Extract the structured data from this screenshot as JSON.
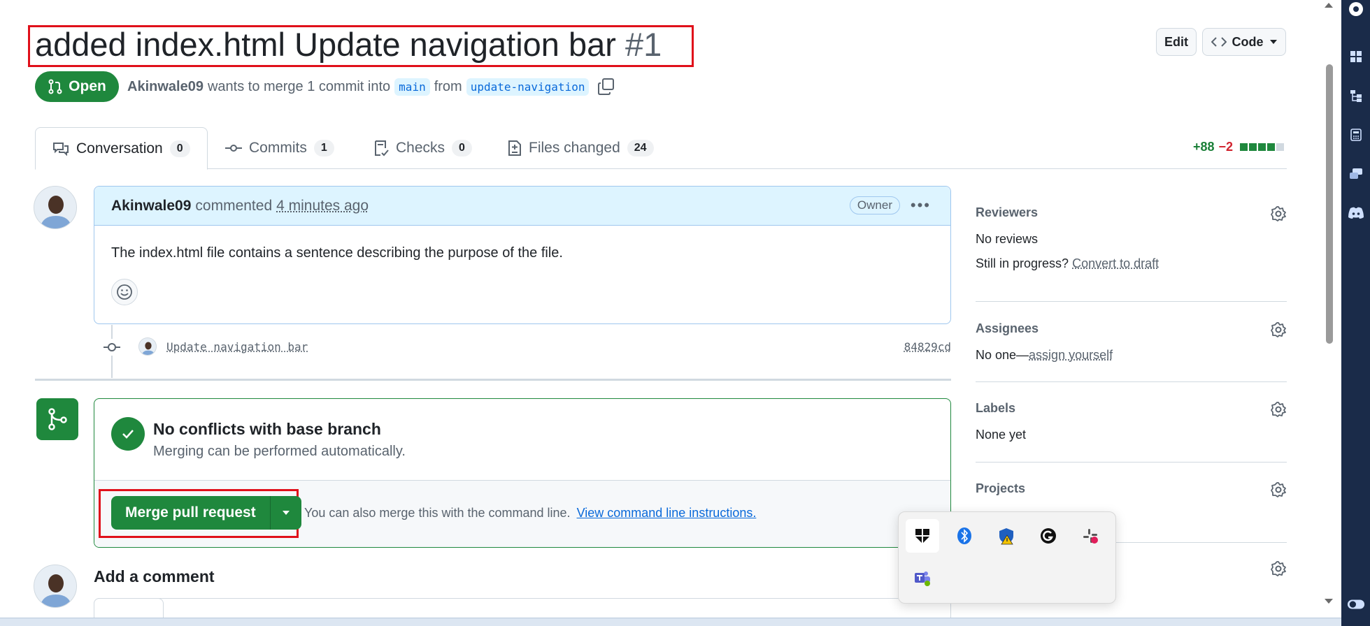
{
  "pr": {
    "title": "added index.html Update navigation bar",
    "number": "#1",
    "state": "Open",
    "author": "Akinwale09",
    "merge_text": "wants to merge 1 commit into",
    "base_branch": "main",
    "from_text": "from",
    "head_branch": "update-navigation"
  },
  "header_buttons": {
    "edit": "Edit",
    "code": "Code"
  },
  "tabs": [
    {
      "label": "Conversation",
      "count": "0"
    },
    {
      "label": "Commits",
      "count": "1"
    },
    {
      "label": "Checks",
      "count": "0"
    },
    {
      "label": "Files changed",
      "count": "24"
    }
  ],
  "diffstat": {
    "additions": "+88",
    "deletions": "−2"
  },
  "comment": {
    "author": "Akinwale09",
    "action": "commented",
    "time": "4 minutes ago",
    "badge": "Owner",
    "body": "The index.html file contains a sentence describing the purpose of the file."
  },
  "commit": {
    "message": "Update navigation bar",
    "sha": "84829cd"
  },
  "merge": {
    "title": "No conflicts with base branch",
    "subtitle": "Merging can be performed automatically.",
    "button": "Merge pull request",
    "hint": "You can also merge this with the command line.",
    "hint_link": "View command line instructions."
  },
  "add_comment": {
    "title": "Add a comment"
  },
  "sidebar": {
    "reviewers": {
      "title": "Reviewers",
      "value": "No reviews",
      "progress_text": "Still in progress?",
      "progress_link": "Convert to draft"
    },
    "assignees": {
      "title": "Assignees",
      "value": "No one—",
      "link": "assign yourself"
    },
    "labels": {
      "title": "Labels",
      "value": "None yet"
    },
    "projects": {
      "title": "Projects"
    }
  },
  "colors": {
    "green": "#1f883d",
    "blue": "#0969da",
    "highlight": "#e0101a"
  }
}
